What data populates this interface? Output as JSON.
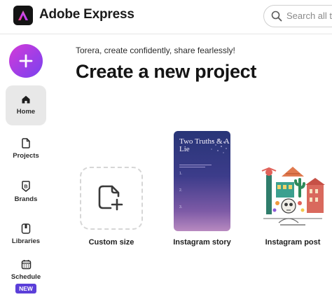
{
  "header": {
    "app_title": "Adobe Express",
    "search_placeholder": "Search all ter"
  },
  "sidebar": {
    "create_icon": "plus-icon",
    "items": [
      {
        "label": "Home",
        "icon": "home-icon",
        "active": true
      },
      {
        "label": "Projects",
        "icon": "file-icon"
      },
      {
        "label": "Brands",
        "icon": "brand-icon"
      },
      {
        "label": "Libraries",
        "icon": "library-icon"
      },
      {
        "label": "Schedule",
        "icon": "calendar-icon",
        "badge": "NEW"
      }
    ]
  },
  "main": {
    "tagline": "Torera, create confidently, share fearlessly!",
    "headline": "Create a new project",
    "templates": [
      {
        "label": "Custom size",
        "icon": "custom-size-icon"
      },
      {
        "label": "Instagram story",
        "preview_title": "Two Truths & A Lie",
        "preview_numbers": [
          "1.",
          "2.",
          "3."
        ]
      },
      {
        "label": "Instagram post"
      }
    ]
  },
  "colors": {
    "accent_gradient": [
      "#d43ad8",
      "#7a43ef"
    ],
    "badge": "#5b3fd9"
  }
}
